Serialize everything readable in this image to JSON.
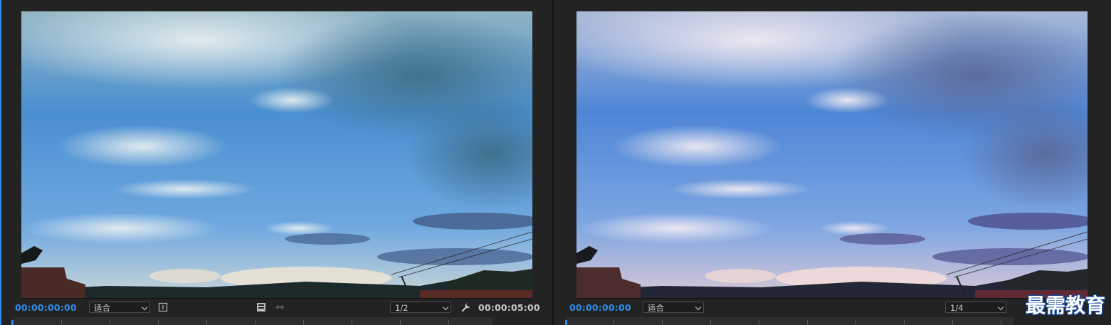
{
  "source_monitor": {
    "timecode_current": "00:00:00:00",
    "zoom_select": "适合",
    "resolution_select": "1/2",
    "timecode_duration": "00:00:05:00"
  },
  "program_monitor": {
    "timecode_current": "00:00:00:00",
    "zoom_select": "适合",
    "resolution_select": "1/4"
  },
  "watermark": "最需教育",
  "colors": {
    "accent": "#2d8ceb",
    "panel_bg": "#232323"
  },
  "icons": {
    "safe_margins": "bracket-icon",
    "export_frame": "camera-icon",
    "settings": "wrench-icon",
    "insert": "insert-icon"
  }
}
